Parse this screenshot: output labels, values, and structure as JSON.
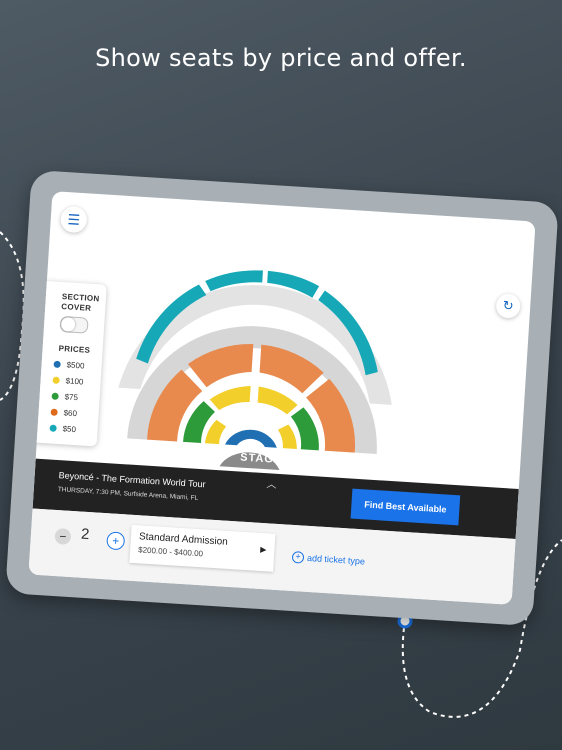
{
  "headline": "Show seats by price and offer.",
  "toolbar": {
    "menu_icon": "list-icon",
    "refresh_icon": "refresh-icon"
  },
  "section_cover": {
    "title_line1": "SECTION",
    "title_line2": "COVER",
    "toggle_on": false
  },
  "prices": {
    "title": "PRICES",
    "items": [
      {
        "label": "$500",
        "color": "#1f6fb2"
      },
      {
        "label": "$100",
        "color": "#f2cf2a"
      },
      {
        "label": "$75",
        "color": "#2e9b3a"
      },
      {
        "label": "$60",
        "color": "#e06a1b"
      },
      {
        "label": "$50",
        "color": "#16a8b7"
      }
    ]
  },
  "stage_label": "STAGE",
  "event": {
    "title": "Beyoncé - The Formation World Tour",
    "subtitle": "THURSDAY, 7:30 PM, Surfside Arena, Miami, FL"
  },
  "find_best_label": "Find Best Available",
  "quantity": {
    "minus": "−",
    "value": "2",
    "plus": "+"
  },
  "ticket": {
    "name": "Standard Admission",
    "range": "$200.00 - $400.00"
  },
  "add_ticket": {
    "icon": "+",
    "label": "add ticket type"
  },
  "colors": {
    "accent": "#1a73e8",
    "seat_teal": "#16a8b7",
    "seat_orange": "#e88a4e",
    "seat_green": "#2e9b3a",
    "seat_yellow": "#f2cf2a",
    "seat_blue": "#1f6fb2"
  }
}
